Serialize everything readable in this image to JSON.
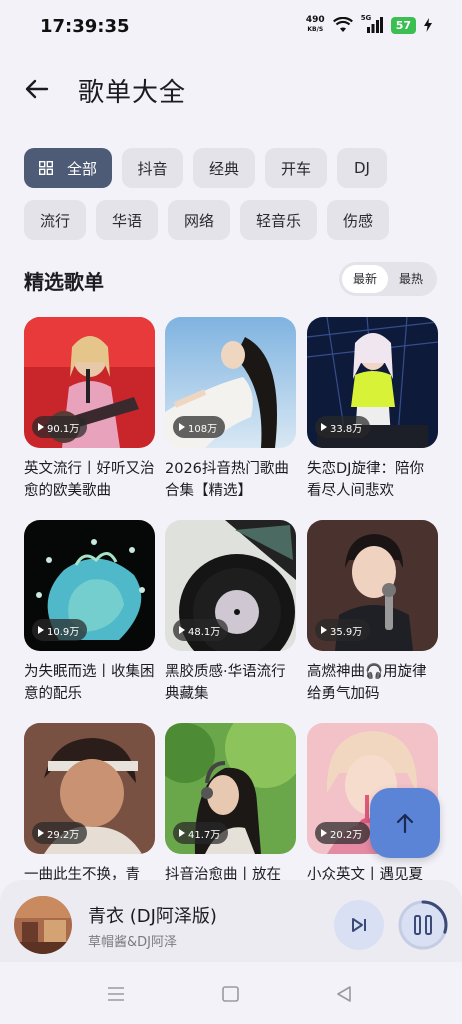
{
  "status": {
    "time": "17:39:35",
    "net_speed": "490",
    "net_unit": "KB/S",
    "signal_type": "5G",
    "battery": "57"
  },
  "header": {
    "title": "歌单大全"
  },
  "categories": [
    "全部",
    "抖音",
    "经典",
    "开车",
    "DJ",
    "流行",
    "华语",
    "网络",
    "轻音乐",
    "伤感"
  ],
  "section": {
    "title": "精选歌单",
    "sort_options": [
      "最新",
      "最热"
    ]
  },
  "playlists": [
    {
      "title": "英文流行丨好听又治愈的欧美歌曲",
      "plays": "90.1万"
    },
    {
      "title": "2026抖音热门歌曲合集【精选】",
      "plays": "108万"
    },
    {
      "title": "失恋DJ旋律：陪你看尽人间悲欢",
      "plays": "33.8万"
    },
    {
      "title": "为失眠而选丨收集困意的配乐",
      "plays": "10.9万"
    },
    {
      "title": "黑胶质感·华语流行典藏集",
      "plays": "48.1万"
    },
    {
      "title": "高燃神曲🎧用旋律给勇气加码",
      "plays": "35.9万"
    },
    {
      "title": "一曲此生不换，青",
      "plays": "29.2万"
    },
    {
      "title": "抖音治愈曲丨放在",
      "plays": "41.7万"
    },
    {
      "title": "小众英文丨遇见夏",
      "plays": "20.2万"
    }
  ],
  "player": {
    "song": "青衣 (DJ阿泽版)",
    "artist": "草帽酱&DJ阿泽",
    "progress": 0.3
  },
  "icons": [
    "back-arrow-icon",
    "grid-icon",
    "play-icon",
    "arrow-up-icon",
    "skip-next-icon",
    "pause-icon",
    "menu-icon",
    "home-icon",
    "back-icon"
  ],
  "colors": {
    "accent": "#4e5b76",
    "fab": "#5c84d6",
    "background": "#f3f2f8"
  }
}
